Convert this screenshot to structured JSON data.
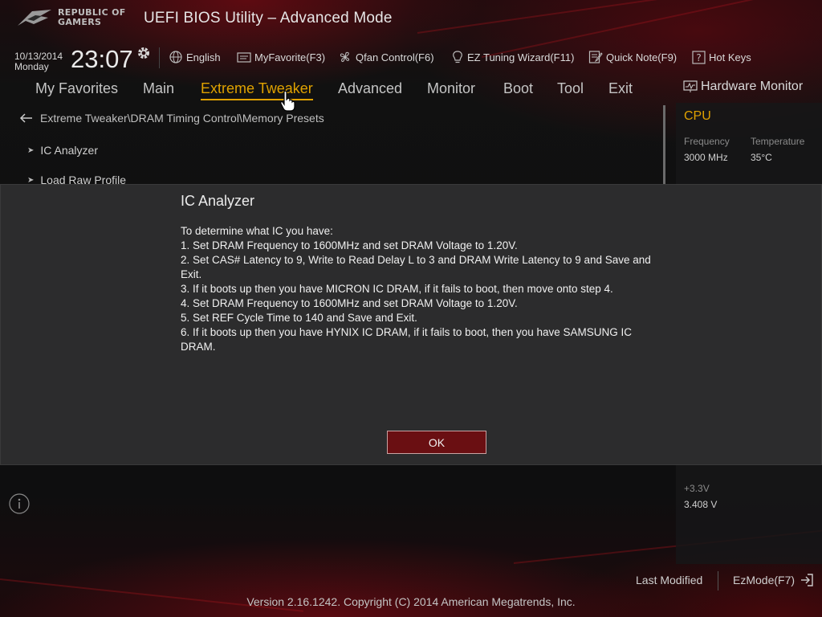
{
  "header": {
    "logo_line1": "REPUBLIC OF",
    "logo_line2": "GAMERS",
    "title": "UEFI BIOS Utility – Advanced Mode",
    "date": "10/13/2014",
    "weekday": "Monday",
    "time": "23:07"
  },
  "toolbar": {
    "language": "English",
    "myfavorite": "MyFavorite(F3)",
    "qfan": "Qfan Control(F6)",
    "ez_tuning": "EZ Tuning Wizard(F11)",
    "quick_note": "Quick Note(F9)",
    "hot_keys": "Hot Keys"
  },
  "menu": {
    "tabs": [
      "My Favorites",
      "Main",
      "Extreme Tweaker",
      "Advanced",
      "Monitor",
      "Boot",
      "Tool",
      "Exit"
    ],
    "active": "Extreme Tweaker"
  },
  "breadcrumb": "Extreme Tweaker\\DRAM Timing Control\\Memory Presets",
  "items": [
    "IC Analyzer",
    "Load Raw Profile"
  ],
  "hardware_monitor": {
    "title": "Hardware Monitor",
    "section": "CPU",
    "frequency_label": "Frequency",
    "frequency_value": "3000 MHz",
    "temperature_label": "Temperature",
    "temperature_value": "35°C",
    "v33_label": "+3.3V",
    "v33_value": "3.408 V"
  },
  "dialog": {
    "title": "IC Analyzer",
    "lines": [
      "To determine what IC you have:",
      "1. Set DRAM Frequency to 1600MHz and set DRAM Voltage to 1.20V.",
      "2. Set CAS# Latency to 9, Write to Read Delay L to 3 and DRAM Write Latency to 9 and Save and Exit.",
      "3. If it boots up then you have MICRON IC DRAM, if it fails to boot, then move onto step 4.",
      "4. Set DRAM Frequency to 1600MHz and set DRAM Voltage to 1.20V.",
      "5. Set REF Cycle Time to 140 and Save and Exit.",
      "6. If it boots up then you have HYNIX IC DRAM, if it fails to boot, then you have SAMSUNG IC DRAM."
    ],
    "ok_label": "OK"
  },
  "footer": {
    "last_modified": "Last Modified",
    "ezmode": "EzMode(F7)",
    "version": "Version 2.16.1242. Copyright (C) 2014 American Megatrends, Inc."
  },
  "colors": {
    "accent": "#e0a100",
    "ok_button": "#6a0f12",
    "dialog_bg": "#2c2c2d"
  }
}
